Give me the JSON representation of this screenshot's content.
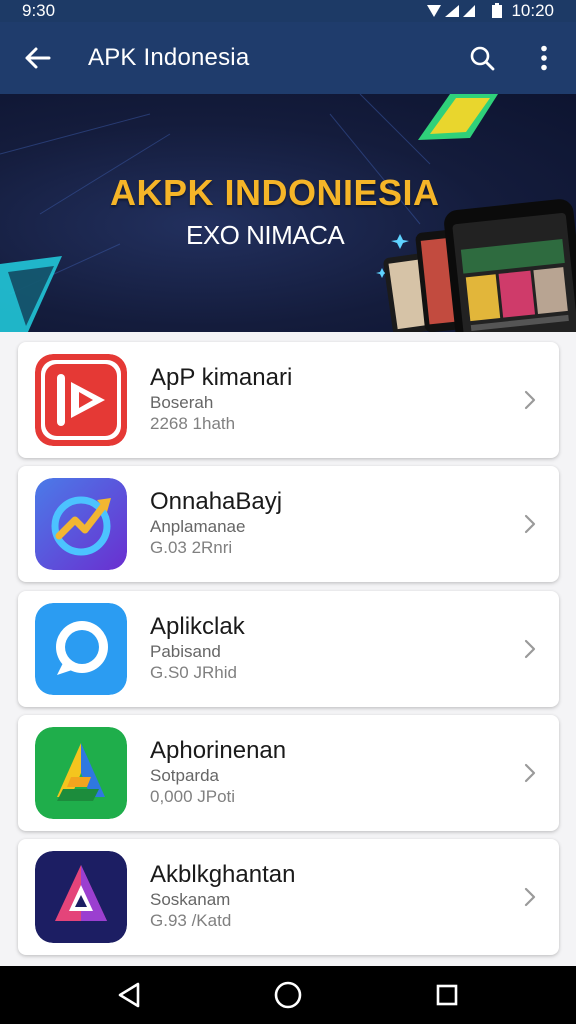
{
  "status_bar": {
    "left_time": "9:30",
    "right_time": "10:20"
  },
  "app_bar": {
    "title": "APK Indonesia",
    "icons": {
      "back": "arrow-left-icon",
      "search": "search-icon",
      "more": "more-vert-icon"
    }
  },
  "banner": {
    "title": "AKPK INDONIESIA",
    "subtitle": "EXO NIMACA"
  },
  "apps": [
    {
      "name": "ApP kimanari",
      "category": "Boserah",
      "meta": "2268 1hath",
      "icon": "red-play-icon",
      "color": "#e53935"
    },
    {
      "name": "OnnahaBayj",
      "category": "Anplamanae",
      "meta": "G.03 2Rnri",
      "icon": "purple-chart-icon",
      "color": "#5b3fd6"
    },
    {
      "name": "Aplikclak",
      "category": "Pabisand",
      "meta": "G.S0 JRhid",
      "icon": "chat-bubble-icon",
      "color": "#2196f3"
    },
    {
      "name": "Aphorinenan",
      "category": "Sotparda",
      "meta": "0,000 JPoti",
      "icon": "green-triangle-icon",
      "color": "#1fae4b"
    },
    {
      "name": "Akblkghantan",
      "category": "Soskanam",
      "meta": "G.93 /Katd",
      "icon": "navy-triangle-icon",
      "color": "#1c1e63"
    }
  ],
  "nav_bar": {
    "icons": [
      "back-triangle-icon",
      "home-circle-icon",
      "recents-square-icon"
    ]
  }
}
